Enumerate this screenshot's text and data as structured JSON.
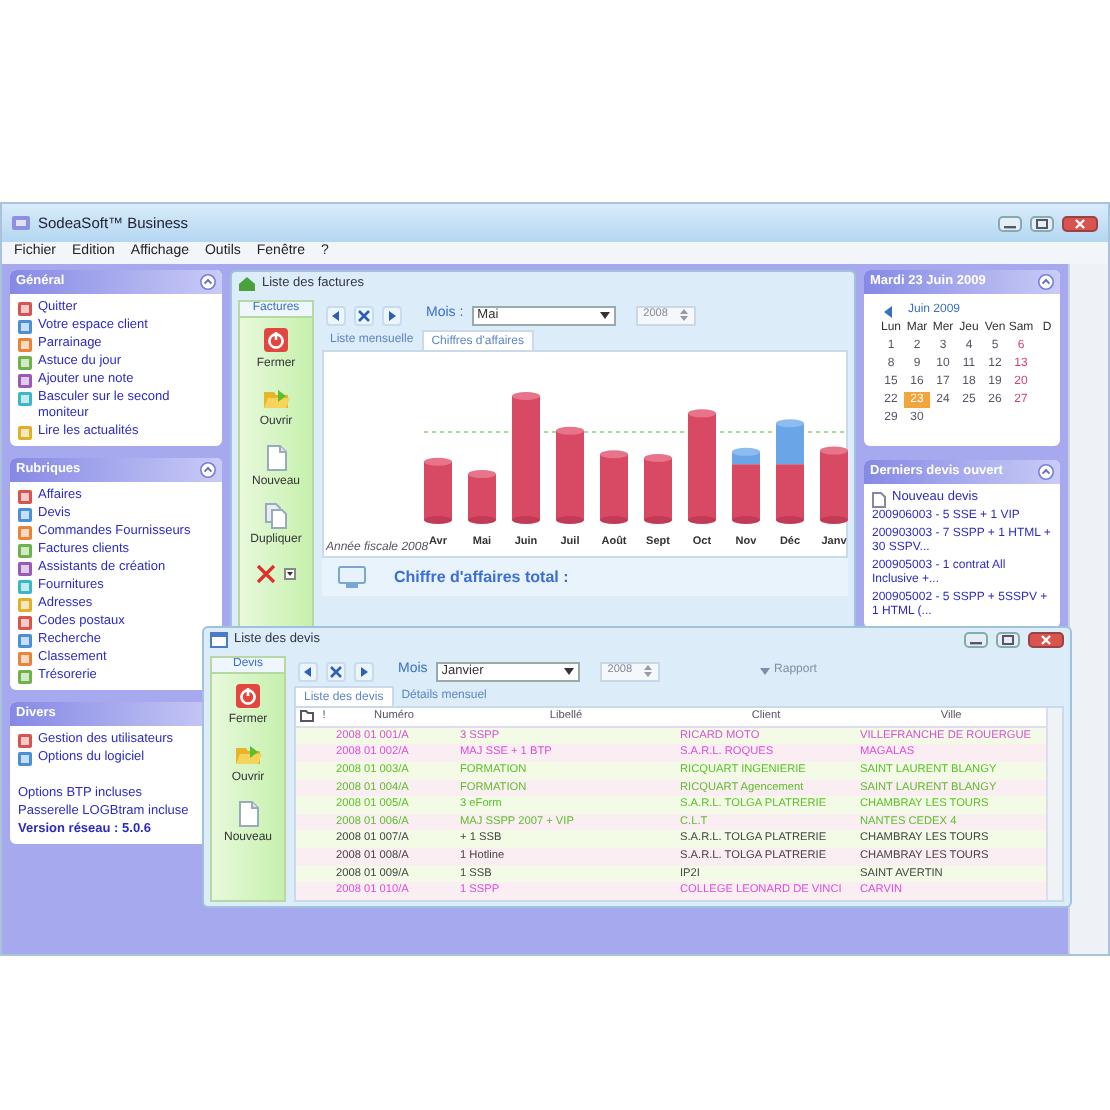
{
  "app": {
    "title": "SodeaSoft™ Business",
    "menu": [
      "Fichier",
      "Edition",
      "Affichage",
      "Outils",
      "Fenêtre",
      "?"
    ]
  },
  "sidebar_panels": [
    {
      "title": "Général",
      "collapse_button": true,
      "items": [
        "Quitter",
        "Votre espace client",
        "Parrainage",
        "Astuce du jour",
        "Ajouter une note",
        "Basculer sur le second moniteur",
        "Lire les actualités"
      ]
    },
    {
      "title": "Rubriques",
      "collapse_button": true,
      "items": [
        "Affaires",
        "Devis",
        "Commandes Fournisseurs",
        "Factures clients",
        "Assistants de création",
        "Fournitures",
        "Adresses",
        "Codes postaux",
        "Recherche",
        "Classement",
        "Trésorerie"
      ]
    },
    {
      "title": "Divers",
      "collapse_button": false,
      "items": [
        "Gestion des utilisateurs",
        "Options du logiciel"
      ],
      "notes": [
        "Options BTP incluses",
        "Passerelle LOGBtram incluse"
      ],
      "version": "Version réseau : 5.0.6"
    }
  ],
  "invoices_window": {
    "title": "Liste des factures",
    "toolbar_tab": "Factures",
    "buttons": [
      "Fermer",
      "Ouvrir",
      "Nouveau",
      "Dupliquer"
    ],
    "month_label": "Mois :",
    "month": "Mai",
    "year": "2008",
    "tabs": [
      {
        "label": "Liste mensuelle",
        "selected": false
      },
      {
        "label": "Chiffres d'affaires",
        "selected": true
      }
    ],
    "chart": {
      "months": [
        "Avr",
        "Mai",
        "Juin",
        "Juil",
        "Août",
        "Sept",
        "Oct",
        "Nov",
        "Déc",
        "Janv"
      ],
      "caption": "Année fiscale 2008"
    },
    "total_label": "Chiffre d'affaires total :"
  },
  "quotes_window": {
    "title": "Liste des devis",
    "toolbar_tab": "Devis",
    "buttons": [
      "Fermer",
      "Ouvrir",
      "Nouveau"
    ],
    "month_label": "Mois",
    "month": "Janvier",
    "year": "2008",
    "report": {
      "label": "Rapport",
      "disabled": true
    },
    "tabs": [
      {
        "label": "Liste des devis",
        "selected": true
      },
      {
        "label": "Détails mensuel",
        "selected": false
      }
    ],
    "columns": [
      "!",
      "Numéro",
      "Libellé",
      "Client",
      "Ville"
    ],
    "rows": [
      {
        "number": "2008 01 001/A",
        "label": "3 SSPP",
        "client": "RICARD MOTO",
        "city": "VILLEFRANCHE DE ROUERGUE",
        "color": "#d84fd8"
      },
      {
        "number": "2008 01 002/A",
        "label": "MAJ SSE + 1 BTP",
        "client": "S.A.R.L. ROQUES",
        "city": "MAGALAS",
        "color": "#d84fd8"
      },
      {
        "number": "2008 01 003/A",
        "label": "FORMATION",
        "client": "RICQUART INGENIERIE",
        "city": "SAINT LAURENT BLANGY",
        "color": "#5cbf2a"
      },
      {
        "number": "2008 01 004/A",
        "label": "FORMATION",
        "client": "RICQUART Agencement",
        "city": "SAINT LAURENT BLANGY",
        "color": "#5cbf2a"
      },
      {
        "number": "2008 01 005/A",
        "label": "3 eForm",
        "client": "S.A.R.L. TOLGA PLATRERIE",
        "city": "CHAMBRAY LES TOURS",
        "color": "#5cbf2a"
      },
      {
        "number": "2008 01 006/A",
        "label": "MAJ SSPP 2007 + VIP",
        "client": "C.L.T",
        "city": "NANTES CEDEX 4",
        "color": "#5cbf2a"
      },
      {
        "number": "2008 01 007/A",
        "label": "+ 1 SSB",
        "client": "S.A.R.L. TOLGA PLATRERIE",
        "city": "CHAMBRAY LES TOURS",
        "color": "#444444"
      },
      {
        "number": "2008 01 008/A",
        "label": "1 Hotline",
        "client": "S.A.R.L. TOLGA PLATRERIE",
        "city": "CHAMBRAY LES TOURS",
        "color": "#444444"
      },
      {
        "number": "2008 01 009/A",
        "label": "1 SSB",
        "client": "IP2I",
        "city": "SAINT AVERTIN",
        "color": "#444444"
      },
      {
        "number": "2008 01 010/A",
        "label": "1 SSPP",
        "client": "COLLEGE LEONARD DE VINCI",
        "city": "CARVIN",
        "color": "#d84fd8"
      }
    ]
  },
  "calendar": {
    "title": "Mardi 23 Juin 2009",
    "collapse_button": true,
    "month": "Juin 2009",
    "weekdays": [
      "Lun",
      "Mar",
      "Mer",
      "Jeu",
      "Ven",
      "Sam",
      "D"
    ],
    "weeks": [
      [
        {
          "day": "1",
          "selected": false
        },
        {
          "day": "2",
          "selected": false
        },
        {
          "day": "3",
          "selected": false
        },
        {
          "day": "4",
          "selected": false
        },
        {
          "day": "5",
          "selected": false
        },
        {
          "day": "6",
          "selected": false
        }
      ],
      [
        {
          "day": "8",
          "selected": false
        },
        {
          "day": "9",
          "selected": false
        },
        {
          "day": "10",
          "selected": false
        },
        {
          "day": "11",
          "selected": false
        },
        {
          "day": "12",
          "selected": false
        },
        {
          "day": "13",
          "selected": false
        }
      ],
      [
        {
          "day": "15",
          "selected": false
        },
        {
          "day": "16",
          "selected": false
        },
        {
          "day": "17",
          "selected": false
        },
        {
          "day": "18",
          "selected": false
        },
        {
          "day": "19",
          "selected": false
        },
        {
          "day": "20",
          "selected": false
        }
      ],
      [
        {
          "day": "22",
          "selected": false
        },
        {
          "day": "23",
          "selected": true
        },
        {
          "day": "24",
          "selected": false
        },
        {
          "day": "25",
          "selected": false
        },
        {
          "day": "26",
          "selected": false
        },
        {
          "day": "27",
          "selected": false
        }
      ],
      [
        {
          "day": "29",
          "selected": false
        },
        {
          "day": "30",
          "selected": false
        }
      ]
    ]
  },
  "recent_quotes": {
    "title": "Derniers devis ouvert",
    "collapse_button": true,
    "new_label": "Nouveau devis",
    "items": [
      "200906003 - 5 SSE + 1 VIP",
      "200903003 - 7 SSPP + 1 HTML + 30 SSPV...",
      "200905003 - 1 contrat All Inclusive +...",
      "200905002 - 5 SSPP + 5SSPV + 1 HTML (..."
    ]
  }
}
